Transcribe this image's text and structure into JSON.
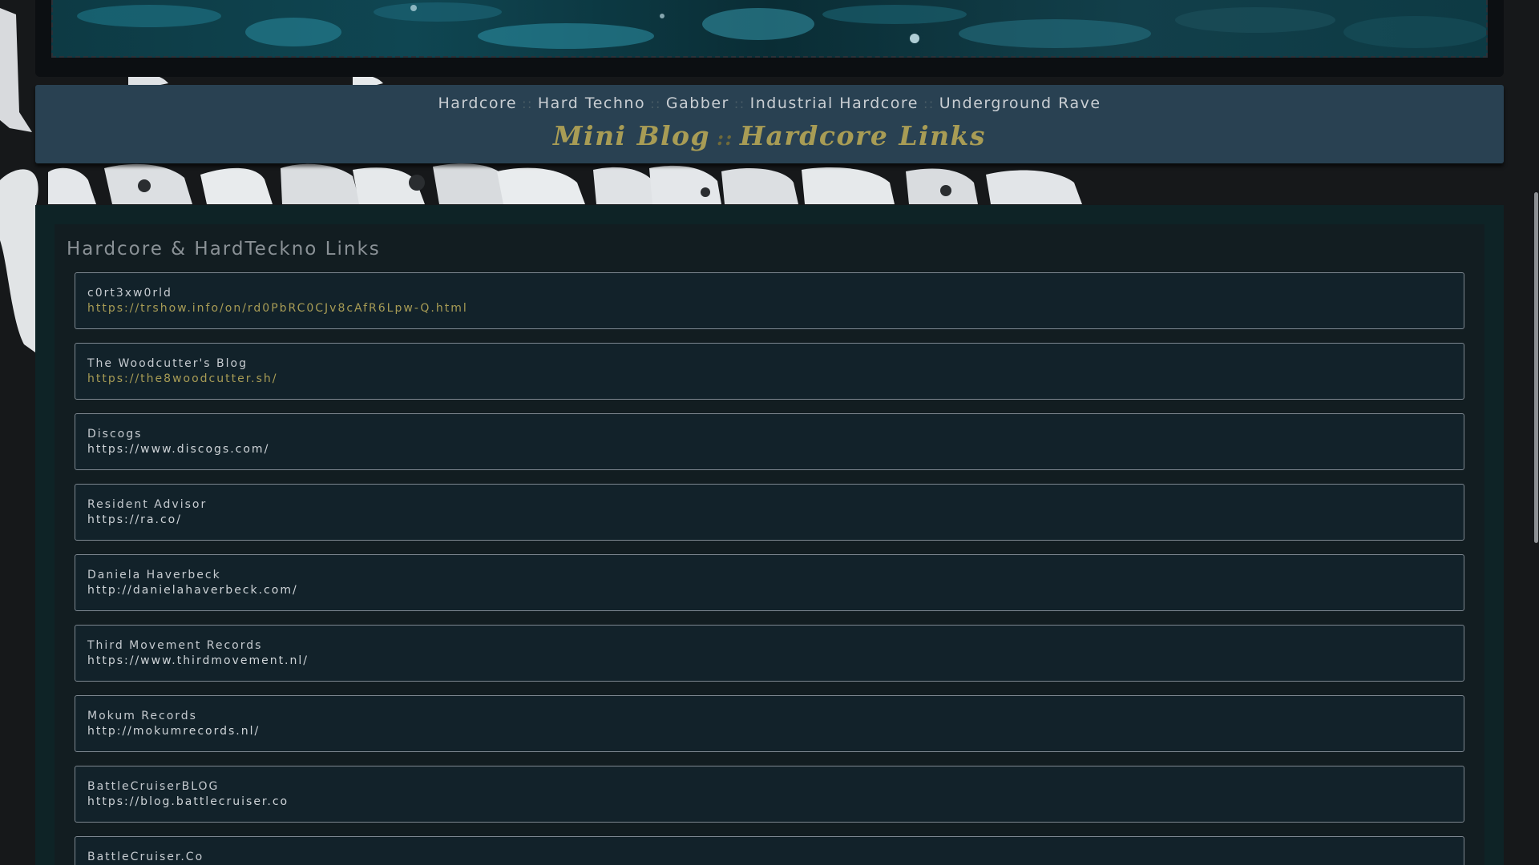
{
  "nav": {
    "links": [
      "Hardcore",
      "Hard Techno",
      "Gabber",
      "Industrial Hardcore",
      "Underground Rave"
    ],
    "separator": "::",
    "title_left": "Mini Blog",
    "title_right": "Hardcore Links"
  },
  "panel": {
    "heading": "Hardcore & HardTeckno Links"
  },
  "links": [
    {
      "name": "c0rt3xw0rld",
      "url": "https://trshow.info/on/rd0PbRC0CJv8cAfR6Lpw-Q.html",
      "visited": true
    },
    {
      "name": "The Woodcutter's Blog",
      "url": "https://the8woodcutter.sh/",
      "visited": true
    },
    {
      "name": "Discogs",
      "url": "https://www.discogs.com/",
      "visited": false
    },
    {
      "name": "Resident Advisor",
      "url": "https://ra.co/",
      "visited": false
    },
    {
      "name": "Daniela Haverbeck",
      "url": "http://danielahaverbeck.com/",
      "visited": false
    },
    {
      "name": "Third Movement Records",
      "url": "https://www.thirdmovement.nl/",
      "visited": false
    },
    {
      "name": "Mokum Records",
      "url": "http://mokumrecords.nl/",
      "visited": false
    },
    {
      "name": "BattleCruiserBLOG",
      "url": "https://blog.battlecruiser.co",
      "visited": false
    },
    {
      "name": "BattleCruiser.Co",
      "url": "",
      "visited": false
    }
  ],
  "colors": {
    "navbar": "#294152",
    "accent_gold": "#a89c55",
    "panel": "#121d21"
  }
}
